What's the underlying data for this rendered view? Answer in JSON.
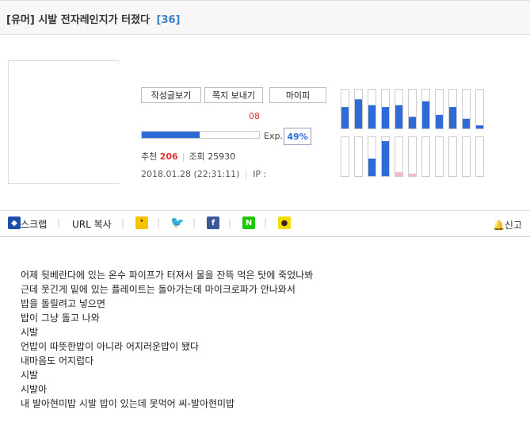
{
  "post": {
    "category": "[유머]",
    "title": "시발 전자레인지가 터졌다",
    "comment_count": "[36]"
  },
  "profile": {
    "buttons": [
      "작성글보기",
      "쪽지 보내기",
      "마이피"
    ],
    "level_text": "08",
    "exp_label": "Exp.",
    "exp_percent": "49%",
    "exp_progress": 49,
    "recommend_label": "추천",
    "recommend_value": "206",
    "views_label": "조회",
    "views_value": "25930",
    "date": "2018.01.28 (22:31:11)",
    "ip_label": "IP :"
  },
  "activity_graph": {
    "color_blue": "#2f6bd6",
    "color_pink": "#f4b8c8",
    "row1": [
      55,
      75,
      60,
      55,
      60,
      30,
      70,
      35,
      55,
      25,
      8
    ],
    "row2": [
      0,
      0,
      45,
      90,
      10,
      5,
      0,
      0,
      0,
      0,
      0
    ],
    "row2_colors": [
      "blue",
      "blue",
      "blue",
      "blue",
      "pink",
      "pink",
      "blue",
      "blue",
      "blue",
      "blue",
      "blue"
    ]
  },
  "share": {
    "scrap_label": "스크랩",
    "url_copy_label": "URL 복사",
    "report_label": "신고"
  },
  "content": {
    "lines": [
      "어제 뒷베란다에 있는 온수 파이프가 터져서 물을 잔뜩 먹은 탓에 죽었나봐",
      "근데 웃긴게 밑에 있는 플레이트는 돌아가는데 마이크로파가 안나와서",
      "밥을 돌릴려고 넣으면",
      "밥이 그냥 돌고 나와",
      "시발",
      "언밥이 따뜻한밥이 아니라 어지러운밥이 됐다",
      "내마음도 어지럽다",
      "시발",
      "시발아",
      "내 발아현미밥 시발 밥이 있는데 못먹어 씨-발아현미밥"
    ]
  }
}
